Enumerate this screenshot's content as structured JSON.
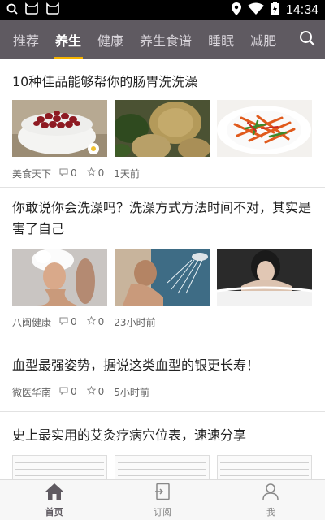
{
  "status_bar": {
    "time": "14:34",
    "icons": [
      "search-icon",
      "notification-cat-icon",
      "notification-cat-icon",
      "location-icon",
      "wifi-icon",
      "battery-charging-icon"
    ]
  },
  "tabs": [
    {
      "label": "推荐",
      "active": false
    },
    {
      "label": "养生",
      "active": true
    },
    {
      "label": "健康",
      "active": false
    },
    {
      "label": "养生食谱",
      "active": false
    },
    {
      "label": "睡眠",
      "active": false
    },
    {
      "label": "减肥",
      "active": false
    }
  ],
  "search_icon": "search-icon",
  "articles": [
    {
      "title": "10种佳品能够帮你的肠胃洗洗澡",
      "source": "美食天下",
      "comments": "0",
      "likes": "0",
      "time": "1天前",
      "images": [
        "red beans in white bowl",
        "chestnut paste balls with mint",
        "shredded carrot salad"
      ]
    },
    {
      "title": "你敢说你会洗澡吗？洗澡方式方法时间不对，其实是害了自己",
      "source": "八闽健康",
      "comments": "0",
      "likes": "0",
      "time": "23小时前",
      "images": [
        "woman washing hair with foam",
        "woman under shower",
        "woman in bathtub"
      ]
    },
    {
      "title": "血型最强姿势，据说这类血型的银更长寿！",
      "source": "微医华南",
      "comments": "0",
      "likes": "0",
      "time": "5小时前"
    },
    {
      "title": "史上最实用的艾灸疗病穴位表，速速分享",
      "images": [
        "acupoint table",
        "acupoint table",
        "acupoint table"
      ]
    }
  ],
  "bottom_nav": [
    {
      "label": "首页",
      "icon": "home-icon",
      "active": true
    },
    {
      "label": "订阅",
      "icon": "subscribe-icon",
      "active": false
    },
    {
      "label": "我",
      "icon": "user-icon",
      "active": false
    }
  ],
  "colors": {
    "tab_bar": "#5f5a61",
    "tab_indicator": "#f6b400",
    "accent": "#5f5a61"
  }
}
